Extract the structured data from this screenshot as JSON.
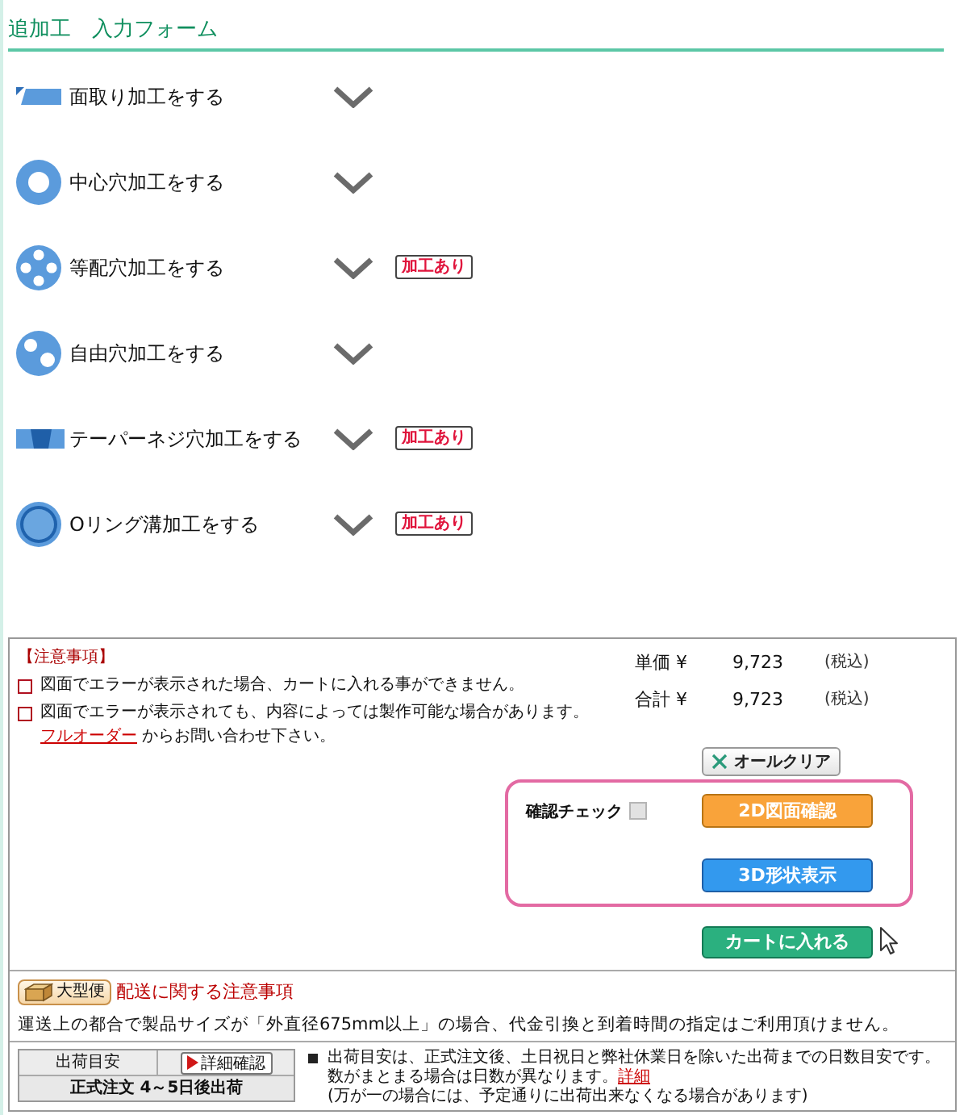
{
  "header": {
    "title": "追加工　入力フォーム"
  },
  "options": [
    {
      "kind": "chamfer",
      "label": "面取り加工をする",
      "expanded": false
    },
    {
      "kind": "center_hole",
      "label": "中心穴加工をする",
      "expanded": false
    },
    {
      "kind": "equal_holes",
      "label": "等配穴加工をする",
      "expanded": false,
      "badge": "加工あり"
    },
    {
      "kind": "free_holes",
      "label": "自由穴加工をする",
      "expanded": false
    },
    {
      "kind": "taper_thread",
      "label": "テーパーネジ穴加工をする",
      "expanded": false,
      "badge": "加工あり"
    },
    {
      "kind": "o_ring",
      "label": "Oリング溝加工をする",
      "expanded": false,
      "badge": "加工あり"
    }
  ],
  "notice": {
    "title": "【注意事項】",
    "items": [
      {
        "text": "図面でエラーが表示された場合、カートに入れる事ができません。"
      },
      {
        "text": "図面でエラーが表示されても、内容によっては製作可能な場合があります。",
        "link": "フルオーダー",
        "after": " からお問い合わせ下さい。"
      }
    ]
  },
  "prices": [
    {
      "label": "単価 ¥",
      "value": "9,723",
      "tax": "(税込)"
    },
    {
      "label": "合計 ¥",
      "value": "9,723",
      "tax": "(税込)"
    }
  ],
  "clear_button": {
    "label": "オールクリア"
  },
  "confirm": {
    "label": "確認チェック",
    "checked": false
  },
  "view_buttons": [
    {
      "kind": "drawing_2d",
      "label": "2D図面確認"
    },
    {
      "kind": "shape_3d",
      "label": "3D形状表示"
    }
  ],
  "cart_button": {
    "label": "カートに入れる"
  },
  "shipping": {
    "badge": "大型便",
    "title": "配送に関する注意事項",
    "text": "運送上の都合で製品サイズが「外直径675mm以上」の場合、代金引換と到着時間の指定はご利用頂けません。"
  },
  "lead_time": {
    "heading": "出荷目安",
    "detail_button": "詳細確認",
    "value": "正式注文 4～5日後出荷",
    "note": "出荷目安は、正式注文後、土日祝日と弊社休業日を除いた出荷までの日数目安です。数がまとまる場合は日数が異なります。",
    "note_link": "詳細",
    "note_2": "(万が一の場合には、予定通りに出荷出来なくなる場合があります)"
  }
}
